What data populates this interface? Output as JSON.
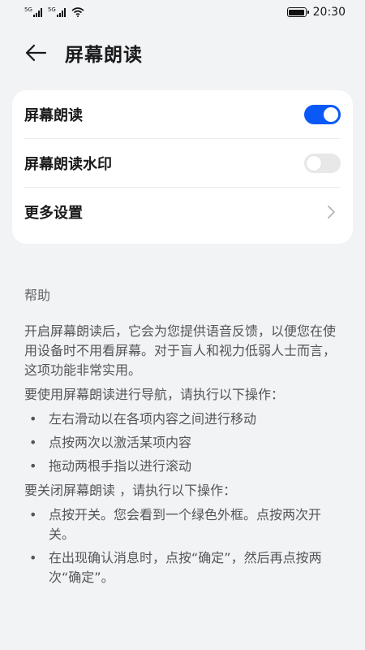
{
  "status": {
    "time": "20:30",
    "sim1_tag": "5G",
    "sim2_tag": "5G"
  },
  "header": {
    "title": "屏幕朗读"
  },
  "settings": {
    "items": [
      {
        "label": "屏幕朗读",
        "control": "toggle",
        "state": "on"
      },
      {
        "label": "屏幕朗读水印",
        "control": "toggle",
        "state": "off"
      },
      {
        "label": "更多设置",
        "control": "chevron"
      }
    ]
  },
  "help": {
    "title": "帮助",
    "intro": "开启屏幕朗读后，它会为您提供语音反馈，以便您在使用设备时不用看屏幕。对于盲人和视力低弱人士而言，这项功能非常实用。",
    "nav_heading": "要使用屏幕朗读进行导航，请执行以下操作：",
    "nav_steps": [
      "左右滑动以在各项内容之间进行移动",
      "点按两次以激活某项内容",
      "拖动两根手指以进行滚动"
    ],
    "off_heading": "要关闭屏幕朗读 ，请执行以下操作：",
    "off_steps": [
      "点按开关。您会看到一个绿色外框。点按两次开关。",
      "在出现确认消息时，点按“确定”，然后再点按两次“确定”。"
    ]
  },
  "colors": {
    "accent": "#0a59f7",
    "background": "#f1f3f5",
    "card": "#ffffff"
  }
}
